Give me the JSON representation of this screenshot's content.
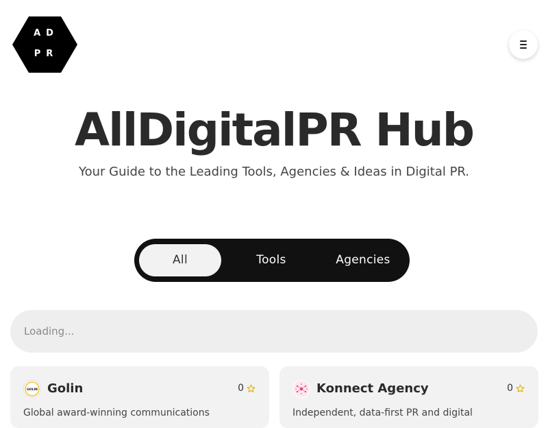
{
  "brand": {
    "logo_line1": "AD",
    "logo_line2": "PR",
    "logo_color": "#000000"
  },
  "header": {
    "menu_icon": "hamburger-icon"
  },
  "hero": {
    "title": "AllDigitalPR Hub",
    "subtitle": "Your Guide to the Leading Tools, Agencies & Ideas in Digital PR."
  },
  "filter": {
    "tabs": [
      {
        "label": "All",
        "active": true
      },
      {
        "label": "Tools",
        "active": false
      },
      {
        "label": "Agencies",
        "active": false
      }
    ],
    "background_color": "#111111"
  },
  "search": {
    "status_text": "Loading..."
  },
  "cards": [
    {
      "name": "Golin",
      "icon": "golin-logo-icon",
      "icon_text": "GOLIN",
      "rating": "0",
      "rating_icon": "star-icon",
      "description": "Global award-winning communications"
    },
    {
      "name": "Konnect Agency",
      "icon": "konnect-logo-icon",
      "rating": "0",
      "rating_icon": "star-icon",
      "description": "Independent, data-first PR and digital"
    }
  ],
  "colors": {
    "star": "#e0b400",
    "card_background": "#f2f2f2",
    "search_background": "#eeeeee"
  }
}
